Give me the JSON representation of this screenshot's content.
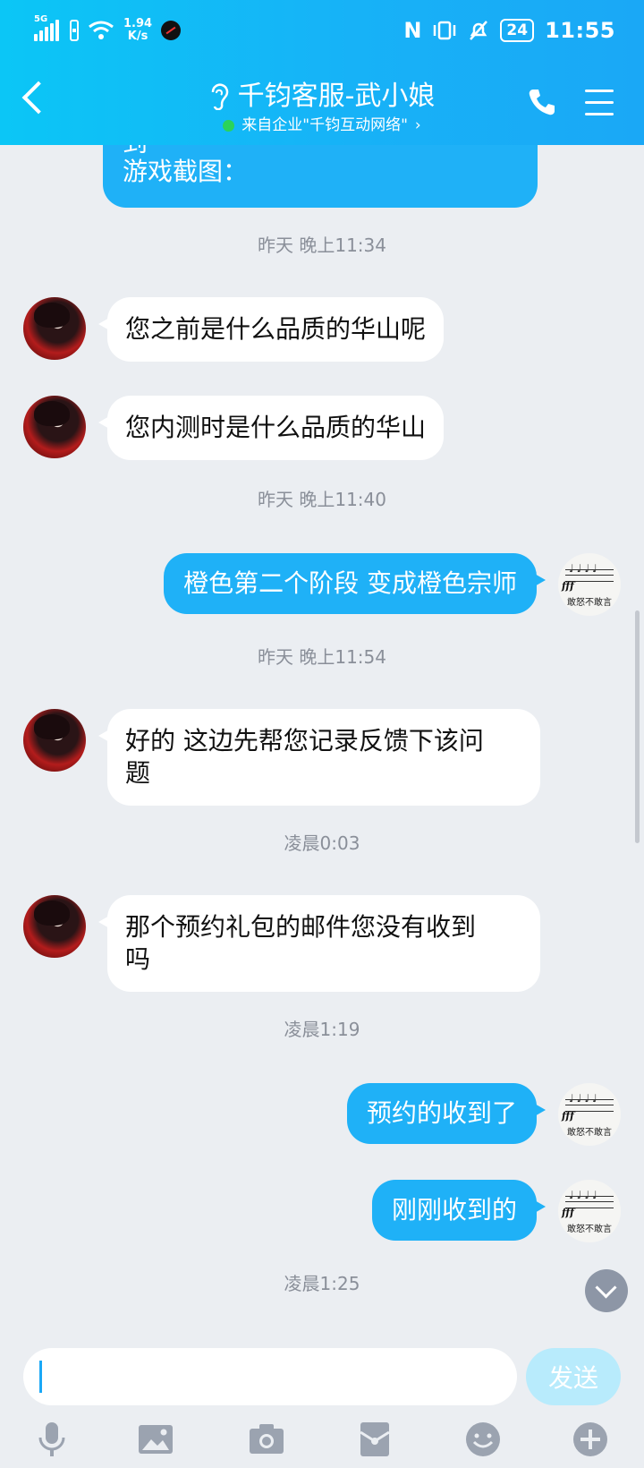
{
  "status_bar": {
    "network": "5G",
    "speed_value": "1.94",
    "speed_unit": "K/s",
    "battery": "24",
    "time": "11:55"
  },
  "header": {
    "title": "千钧客服-武小娘",
    "subtitle": "来自企业\"千钧互动网络\"",
    "subtitle_arrow": "›",
    "ear_icon": "ear-icon",
    "phone_icon": "phone-icon",
    "menu_icon": "menu-icon"
  },
  "messages": {
    "m0": {
      "from": "me",
      "partial_line": "到",
      "text": "游戏截图："
    },
    "t1": "昨天 晚上11:34",
    "m1": {
      "from": "cs",
      "text": "您之前是什么品质的华山呢"
    },
    "m2": {
      "from": "cs",
      "text": "您内测时是什么品质的华山"
    },
    "t2": "昨天 晚上11:40",
    "m3": {
      "from": "me",
      "text": "橙色第二个阶段 变成橙色宗师"
    },
    "t3": "昨天 晚上11:54",
    "m4": {
      "from": "cs",
      "line1": "好的  这边先帮您记录反馈下该问",
      "line2": "题"
    },
    "t4": "凌晨0:03",
    "m5": {
      "from": "cs",
      "line1": "那个预约礼包的邮件您没有收到",
      "line2": "吗"
    },
    "t5": "凌晨1:19",
    "m6": {
      "from": "me",
      "text": "预约的收到了"
    },
    "m7": {
      "from": "me",
      "text": "刚刚收到的"
    },
    "t6": "凌晨1:25"
  },
  "my_avatar": {
    "notes": "♩♩♩♩",
    "dynamic": "fff",
    "caption": "敢怒不敢言"
  },
  "input": {
    "value": "",
    "placeholder": "",
    "send_label": "发送"
  },
  "toolbar_icons": [
    "microphone-icon",
    "image-icon",
    "camera-icon",
    "red-packet-icon",
    "emoji-icon",
    "plus-icon"
  ],
  "colors": {
    "header_start": "#0bc6f6",
    "header_end": "#1aa8f6",
    "outgoing_bubble": "#1fb1f7",
    "incoming_bubble": "#ffffff",
    "background": "#ebeef2",
    "send_button": "#b8ebfc"
  }
}
